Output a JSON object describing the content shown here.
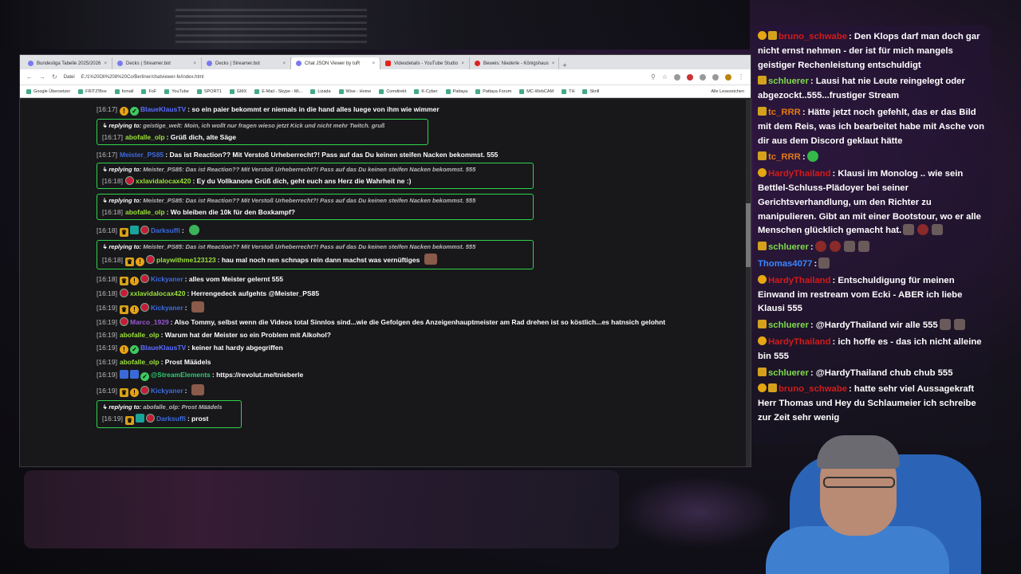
{
  "browser": {
    "tabs": [
      {
        "label": "Bundesliga Tabelle 2025/2026",
        "icon": "generic-favicon"
      },
      {
        "label": "Decks | Streamer.bot",
        "icon": "streamerbot-favicon"
      },
      {
        "label": "Decks | Streamer.bot",
        "icon": "streamerbot-favicon"
      },
      {
        "label": "Chat JSON Viewer by tuR",
        "icon": "generic-favicon",
        "active": true
      },
      {
        "label": "Videodetails - YouTube Studio",
        "icon": "youtube-favicon"
      },
      {
        "label": "Beweis: Niederle - Königshaus",
        "icon": "red-favicon"
      }
    ],
    "url_prefix": "Datei",
    "url": "E:/1%20Oli%208%20Co/Berliner/chatviewer-fe/index.html",
    "bookmarks": [
      "Google Übersetzer",
      "FRITZ!Box",
      "fomall",
      "FoF",
      "YouTube",
      "SPORT1",
      "GMX",
      "E-Mail - Skype - Mi...",
      "Lizada",
      "Wise - Home",
      "Comdirekt",
      "K-Cyber",
      "Pattaya",
      "Pattaya Forum",
      "MC-WebCAM",
      "TH",
      "Skrill"
    ],
    "bookmarks_right": "Alle Lesezeichen"
  },
  "chat": [
    {
      "type": "msg",
      "ts": "[16:17]",
      "badges": [
        "gold",
        "green"
      ],
      "user": "BlaueKlausTV",
      "color": "#5b6cff",
      "text": ": so ein paier bekommt er niemals in die hand alles luege von ihm wie wimmer"
    },
    {
      "type": "reply",
      "width": "w2",
      "reply_to": "geistige_welt: Moin, ich wollt nur fragen wieso jetzt Kick und nicht mehr Twitch. gruß",
      "ts": "[16:17]",
      "badges": [],
      "user": "abofalle_olp",
      "color": "#9be238",
      "text": ": Grüß dich, alte Säge"
    },
    {
      "type": "msg",
      "ts": "[16:17]",
      "badges": [],
      "user": "Meister_PS85",
      "color": "#3d6be0",
      "text": ": Das ist Reaction?? Mit Verstoß Urheberrecht?! Pass auf das Du keinen steifen Nacken bekommst. 555"
    },
    {
      "type": "reply",
      "width": "",
      "reply_to": "Meister_PS85: Das ist Reaction?? Mit Verstoß Urheberrecht?! Pass auf das Du keinen steifen Nacken bekommst. 555",
      "ts": "[16:18]",
      "badges": [
        "red"
      ],
      "user": "xxlavidalocax420",
      "color": "#9be238",
      "text": ": Ey du Vollkanone Grüß dich, geht euch ans Herz die Wahrheit ne :)"
    },
    {
      "type": "reply",
      "width": "",
      "reply_to": "Meister_PS85: Das ist Reaction?? Mit Verstoß Urheberrecht?! Pass auf das Du keinen steifen Nacken bekommst. 555",
      "ts": "[16:18]",
      "badges": [],
      "user": "abofalle_olp",
      "color": "#9be238",
      "text": ": Wo bleiben die 10k für den Boxkampf?"
    },
    {
      "type": "msg",
      "ts": "[16:18]",
      "badges": [
        "crown",
        "teal",
        "red"
      ],
      "user": "Darksuffi",
      "color": "#3d6be0",
      "text": ":",
      "emote": "green"
    },
    {
      "type": "reply",
      "width": "",
      "reply_to": "Meister_PS85: Das ist Reaction?? Mit Verstoß Urheberrecht?! Pass auf das Du keinen steifen Nacken bekommst. 555",
      "ts": "[16:18]",
      "badges": [
        "crown",
        "gold",
        "red"
      ],
      "user": "playwithme123123",
      "color": "#9be238",
      "text": ": hau mal noch nen schnaps rein dann machst was vernüftiges",
      "emote": "pic"
    },
    {
      "type": "msg",
      "ts": "[16:18]",
      "badges": [
        "crown",
        "gold",
        "red"
      ],
      "user": "Kickyaner",
      "color": "#3d6be0",
      "text": ": alles vom Meister gelernt 555"
    },
    {
      "type": "msg",
      "ts": "[16:18]",
      "badges": [
        "red"
      ],
      "user": "xxlavidalocax420",
      "color": "#9be238",
      "text": ": Herrengedeck aufgehts @Meister_PS85"
    },
    {
      "type": "msg",
      "ts": "[16:19]",
      "badges": [
        "crown",
        "gold",
        "red"
      ],
      "user": "Kickyaner",
      "color": "#3d6be0",
      "text": ":",
      "emote": "pic"
    },
    {
      "type": "msg",
      "ts": "[16:19]",
      "badges": [
        "red"
      ],
      "user": "Marco_1929",
      "color": "#9b59d0",
      "text": ": Also Tommy, selbst wenn die Videos total Sinnlos sind...wie die Gefolgen des Anzeigenhauptmeister am Rad drehen ist so köstlich...es hatnsich gelohnt"
    },
    {
      "type": "msg",
      "ts": "[16:19]",
      "badges": [],
      "user": "abofalle_olp",
      "color": "#9be238",
      "text": ": Warum hat der Meister so ein Problem mit Alkohol?"
    },
    {
      "type": "msg",
      "ts": "[16:19]",
      "badges": [
        "gold",
        "green"
      ],
      "user": "BlaueKlausTV",
      "color": "#5b6cff",
      "text": ": keiner hat hardy abgegriffen"
    },
    {
      "type": "msg",
      "ts": "[16:19]",
      "badges": [],
      "user": "abofalle_olp",
      "color": "#9be238",
      "text": ": Prost Määdels"
    },
    {
      "type": "msg",
      "ts": "[16:19]",
      "badges": [
        "blue",
        "blue",
        "green"
      ],
      "user": "@StreamElements",
      "color": "#2ecc71",
      "text": ": https://revolut.me/tnieberle"
    },
    {
      "type": "msg",
      "ts": "[16:19]",
      "badges": [
        "crown",
        "gold",
        "red"
      ],
      "user": "Kickyaner",
      "color": "#3d6be0",
      "text": ":",
      "emote": "pic"
    },
    {
      "type": "reply",
      "width": "w3",
      "reply_to": "abofalle_olp: Prost Määdels",
      "ts": "[16:19]",
      "badges": [
        "crown",
        "teal",
        "red"
      ],
      "user": "Darksuffi",
      "color": "#3d6be0",
      "text": ": prost"
    }
  ],
  "overlay": [
    {
      "icons": [
        "warn",
        "crown"
      ],
      "user": "bruno_schwabe",
      "color": "#d11c1c",
      "text": ": Den Klops darf man doch gar nicht ernst nehmen - der ist für mich mangels geistiger Rechenleistung entschuldigt"
    },
    {
      "icons": [
        "crown"
      ],
      "user": "schluerer",
      "color": "#7edb4a",
      "text": ": Lausi hat nie Leute reingelegt oder abgezockt..555...frustiger Stream"
    },
    {
      "icons": [
        "crown"
      ],
      "user": "tc_RRR",
      "color": "#e07a1a",
      "text": ": Hätte jetzt noch gefehlt, das er das Bild mit dem Reis, was ich bearbeitet habe mit Asche von dir aus dem Discord geklaut hätte"
    },
    {
      "icons": [
        "crown"
      ],
      "user": "tc_RRR",
      "color": "#e07a1a",
      "text": ":",
      "emotes": [
        "green"
      ]
    },
    {
      "icons": [
        "warn"
      ],
      "user": "HardyThailand",
      "color": "#d11c1c",
      "text": ": Klausi im Monolog .. wie sein Bettlel-Schluss-Plädoyer bei seiner Gerichtsverhandlung, um den Richter zu manipulieren. Gibt an mit einer Bootstour, wo er alle Menschen glücklich gemacht hat.",
      "emotes": [
        "pic",
        "red",
        "pic"
      ]
    },
    {
      "icons": [
        "crown"
      ],
      "user": "schluerer",
      "color": "#7edb4a",
      "text": ":",
      "emotes": [
        "red",
        "red",
        "pic",
        "pic"
      ]
    },
    {
      "icons": [],
      "user": "Thomas4077",
      "color": "#3a86ff",
      "text": ":",
      "emotes": [
        "pic"
      ]
    },
    {
      "icons": [
        "warn"
      ],
      "user": "HardyThailand",
      "color": "#d11c1c",
      "text": ": Entschuldigung für meinen Einwand im restream vom Ecki - ABER ich liebe Klausi 555"
    },
    {
      "icons": [
        "crown"
      ],
      "user": "schluerer",
      "color": "#7edb4a",
      "text": ": @HardyThailand wir alle 555",
      "emotes": [
        "pic",
        "pic"
      ]
    },
    {
      "icons": [
        "warn"
      ],
      "user": "HardyThailand",
      "color": "#d11c1c",
      "text": ": ich hoffe es - das ich nicht alleine bin 555"
    },
    {
      "icons": [
        "crown"
      ],
      "user": "schluerer",
      "color": "#7edb4a",
      "text": ": @HardyThailand chub chub 555"
    },
    {
      "icons": [
        "warn",
        "crown"
      ],
      "user": "bruno_schwabe",
      "color": "#d11c1c",
      "text": ": hatte sehr viel Aussagekraft Herr Thomas und Hey du Schlaumeier ich schreibe zur Zeit sehr wenig"
    }
  ],
  "labels": {
    "replying_to": "replying to:"
  }
}
